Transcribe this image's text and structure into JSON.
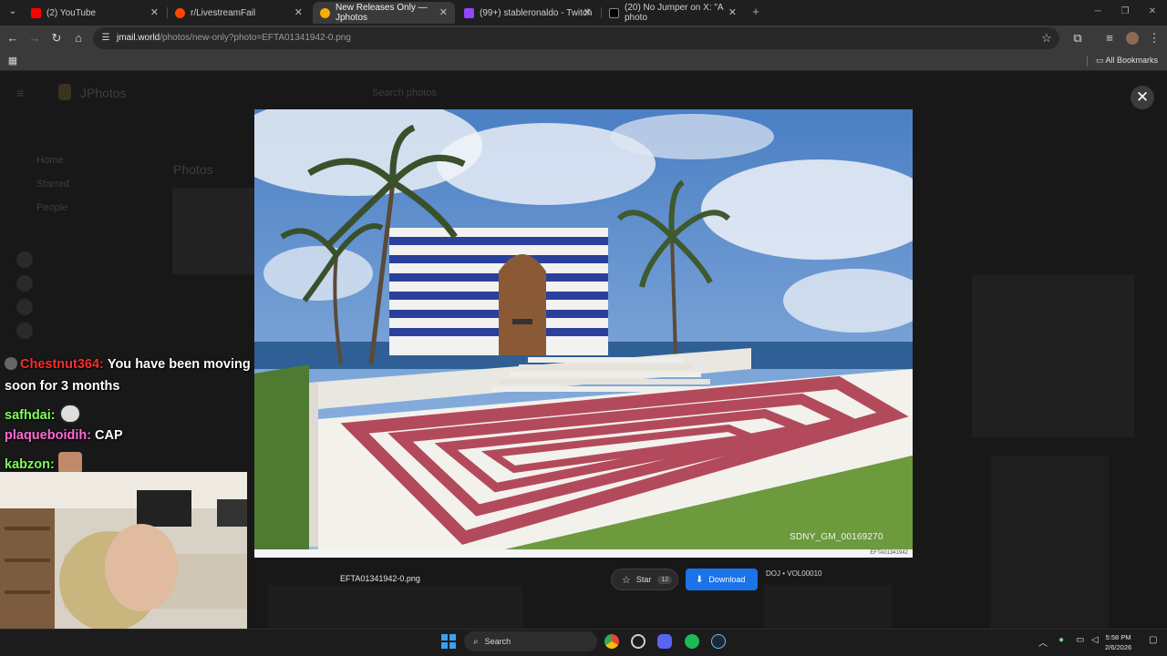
{
  "browser": {
    "tabs": [
      {
        "title": "(2) YouTube",
        "color": "#ff0000",
        "active": false
      },
      {
        "title": "r/LivestreamFail",
        "color": "#ff4500",
        "active": false
      },
      {
        "title": "New Releases Only — Jphotos",
        "color": "#f9ab00",
        "active": true
      },
      {
        "title": "(99+) stableronaldo - Twitch",
        "color": "#9146ff",
        "active": false
      },
      {
        "title": "(20) No Jumper on X: \"A photo",
        "color": "#e7e9ea",
        "active": false
      }
    ],
    "url_host": "jmail.world",
    "url_path": "/photos/new-only?photo=EFTA01341942-0.png",
    "all_bookmarks": "All Bookmarks"
  },
  "background_app": {
    "brand": "JPhotos",
    "search_placeholder": "Search photos",
    "nav": [
      "Home",
      "Starred",
      "People"
    ],
    "section_title": "Photos"
  },
  "viewer": {
    "photo_caption": "SDNY_GM_00169270",
    "photo_id": "EFTA01341942",
    "filename": "EFTA01341942-0.png",
    "star_label": "Star",
    "star_count": "12",
    "download_label": "Download",
    "volume": "DOJ • VOL00010",
    "close_icon": "close-icon"
  },
  "chat": [
    {
      "user": "Chestnut364:",
      "color": "#ff2d2d",
      "text": "You have been moving"
    },
    {
      "user": "",
      "color": "#ffffff",
      "text": "soon for 3 months"
    },
    {
      "user": "safhdai:",
      "color": "#7dff5a",
      "text": ""
    },
    {
      "user": "plaqueboidih:",
      "color": "#ff6ad5",
      "text": "CAP"
    },
    {
      "user": "kabzon:",
      "color": "#7dff5a",
      "text": ""
    }
  ],
  "taskbar": {
    "search_label": "Search",
    "time": "5:58 PM",
    "date": "2/6/2026"
  }
}
